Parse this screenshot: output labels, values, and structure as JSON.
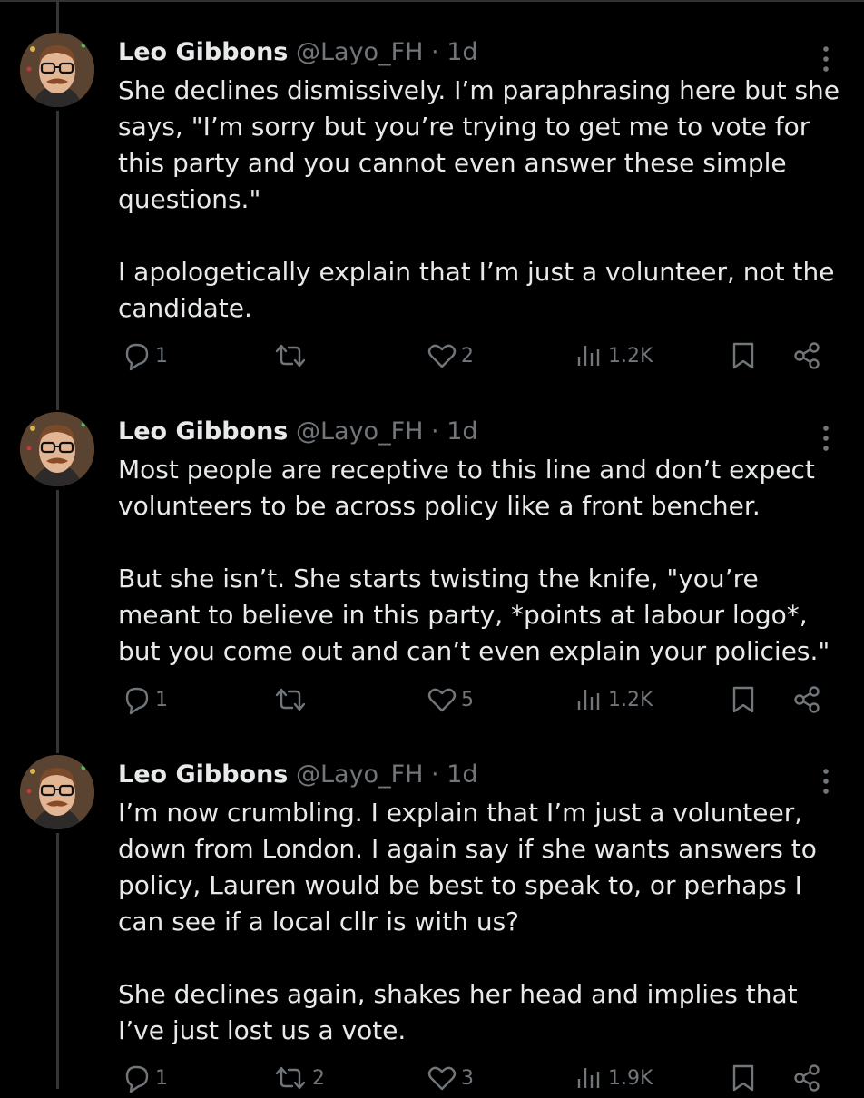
{
  "tweets": [
    {
      "author": {
        "name": "Leo Gibbons",
        "handle": "@Layo_FH",
        "separator": "·",
        "time": "1d"
      },
      "paragraphs": [
        "She declines dismissively. I’m paraphrasing here but she says, \"I’m sorry but you’re trying to get me to vote for this party and you cannot even answer these simple questions.\"",
        "I apologetically explain that I’m just a volunteer, not the candidate."
      ],
      "stats": {
        "replies": "1",
        "reposts": "",
        "likes": "2",
        "views": "1.2K"
      }
    },
    {
      "author": {
        "name": "Leo Gibbons",
        "handle": "@Layo_FH",
        "separator": "·",
        "time": "1d"
      },
      "paragraphs": [
        "Most people are receptive to this line and don’t expect volunteers to be across policy like a front bencher.",
        "But she isn’t. She starts twisting the knife, \"you’re meant to believe in this party, *points at labour logo*, but you come out and can’t even explain your policies.\""
      ],
      "stats": {
        "replies": "1",
        "reposts": "",
        "likes": "5",
        "views": "1.2K"
      }
    },
    {
      "author": {
        "name": "Leo Gibbons",
        "handle": "@Layo_FH",
        "separator": "·",
        "time": "1d"
      },
      "paragraphs": [
        "I’m now crumbling. I explain that I’m just a volunteer, down from London. I again say if she wants answers to policy, Lauren would be best to speak to, or perhaps I can see if a local cllr is with us?",
        "She declines again, shakes her head and implies that I’ve just lost us a vote."
      ],
      "stats": {
        "replies": "1",
        "reposts": "2",
        "likes": "3",
        "views": "1.9K"
      }
    }
  ],
  "icons": {
    "reply": "reply-icon",
    "repost": "repost-icon",
    "like": "heart-icon",
    "views": "views-bar-chart-icon",
    "bookmark": "bookmark-icon",
    "share": "share-icon",
    "more": "more-vertical-icon"
  },
  "colors": {
    "background": "#000000",
    "text": "#e7e9ea",
    "muted": "#71767b",
    "thread_line": "#333639"
  }
}
